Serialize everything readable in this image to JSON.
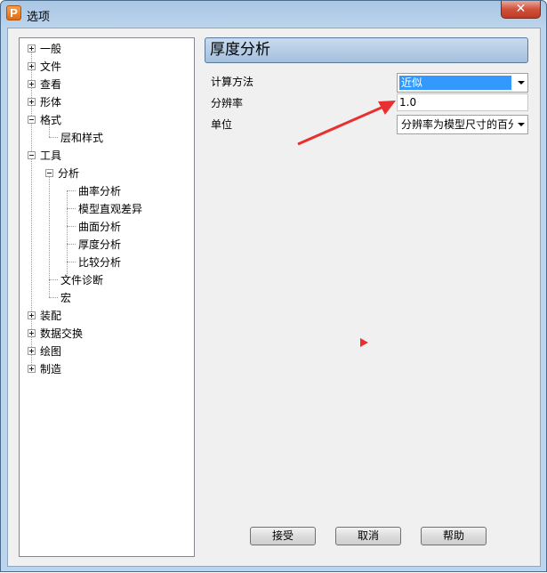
{
  "window": {
    "title": "选项",
    "app_icon_letter": "P"
  },
  "tree": {
    "items": [
      {
        "label": "一般",
        "expander": "plus"
      },
      {
        "label": "文件",
        "expander": "plus"
      },
      {
        "label": "查看",
        "expander": "plus"
      },
      {
        "label": "形体",
        "expander": "plus"
      },
      {
        "label": "格式",
        "expander": "minus"
      },
      {
        "label": "层和样式",
        "expander": "none"
      },
      {
        "label": "工具",
        "expander": "minus"
      },
      {
        "label": "分析",
        "expander": "minus"
      },
      {
        "label": "曲率分析",
        "expander": "none"
      },
      {
        "label": "模型直观差异",
        "expander": "none"
      },
      {
        "label": "曲面分析",
        "expander": "none"
      },
      {
        "label": "厚度分析",
        "expander": "none"
      },
      {
        "label": "比较分析",
        "expander": "none"
      },
      {
        "label": "文件诊断",
        "expander": "none"
      },
      {
        "label": "宏",
        "expander": "none"
      },
      {
        "label": "装配",
        "expander": "plus"
      },
      {
        "label": "数据交换",
        "expander": "plus"
      },
      {
        "label": "绘图",
        "expander": "plus"
      },
      {
        "label": "制造",
        "expander": "plus"
      }
    ]
  },
  "panel": {
    "title": "厚度分析",
    "rows": [
      {
        "label": "计算方法",
        "value": "近似",
        "control": "dropdown",
        "selected": true
      },
      {
        "label": "分辨率",
        "value": "1.0",
        "control": "text"
      },
      {
        "label": "单位",
        "value": "分辨率为模型尺寸的百分",
        "control": "dropdown"
      }
    ]
  },
  "buttons": {
    "accept": "接受",
    "cancel": "取消",
    "help": "帮助"
  },
  "colors": {
    "selection": "#3399ff",
    "annotation_arrow": "#e83030",
    "panel_header": "#a4bfdd"
  }
}
